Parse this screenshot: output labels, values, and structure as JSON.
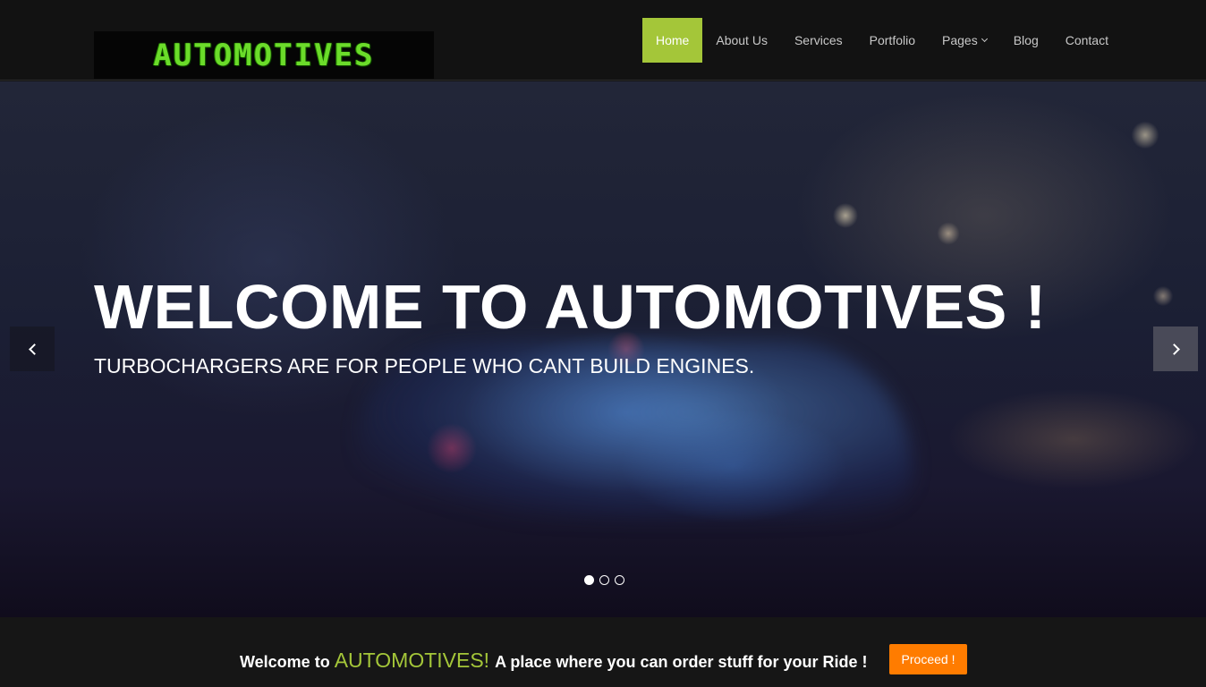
{
  "header": {
    "logo_text": "AUTOMOTIVES",
    "nav": [
      {
        "label": "Home",
        "active": true
      },
      {
        "label": "About Us",
        "active": false
      },
      {
        "label": "Services",
        "active": false
      },
      {
        "label": "Portfolio",
        "active": false
      },
      {
        "label": "Pages",
        "active": false,
        "dropdown": true
      },
      {
        "label": "Blog",
        "active": false
      },
      {
        "label": "Contact",
        "active": false
      }
    ]
  },
  "hero": {
    "title": "WELCOME TO AUTOMOTIVES !",
    "subtitle": "TURBOCHARGERS ARE FOR PEOPLE WHO CANT BUILD ENGINES.",
    "prev_icon": "chevron-left-icon",
    "next_icon": "chevron-right-icon",
    "slide_count": 3,
    "active_slide": 1
  },
  "welcome": {
    "prefix": "Welcome to",
    "brand": "AUTOMOTIVES!",
    "suffix": "A place where you can order stuff for your Ride !",
    "button_label": "Proceed !"
  },
  "colors": {
    "accent_green": "#a4c639",
    "button_orange": "#ff7c00",
    "logo_green": "#6bdc2a"
  }
}
